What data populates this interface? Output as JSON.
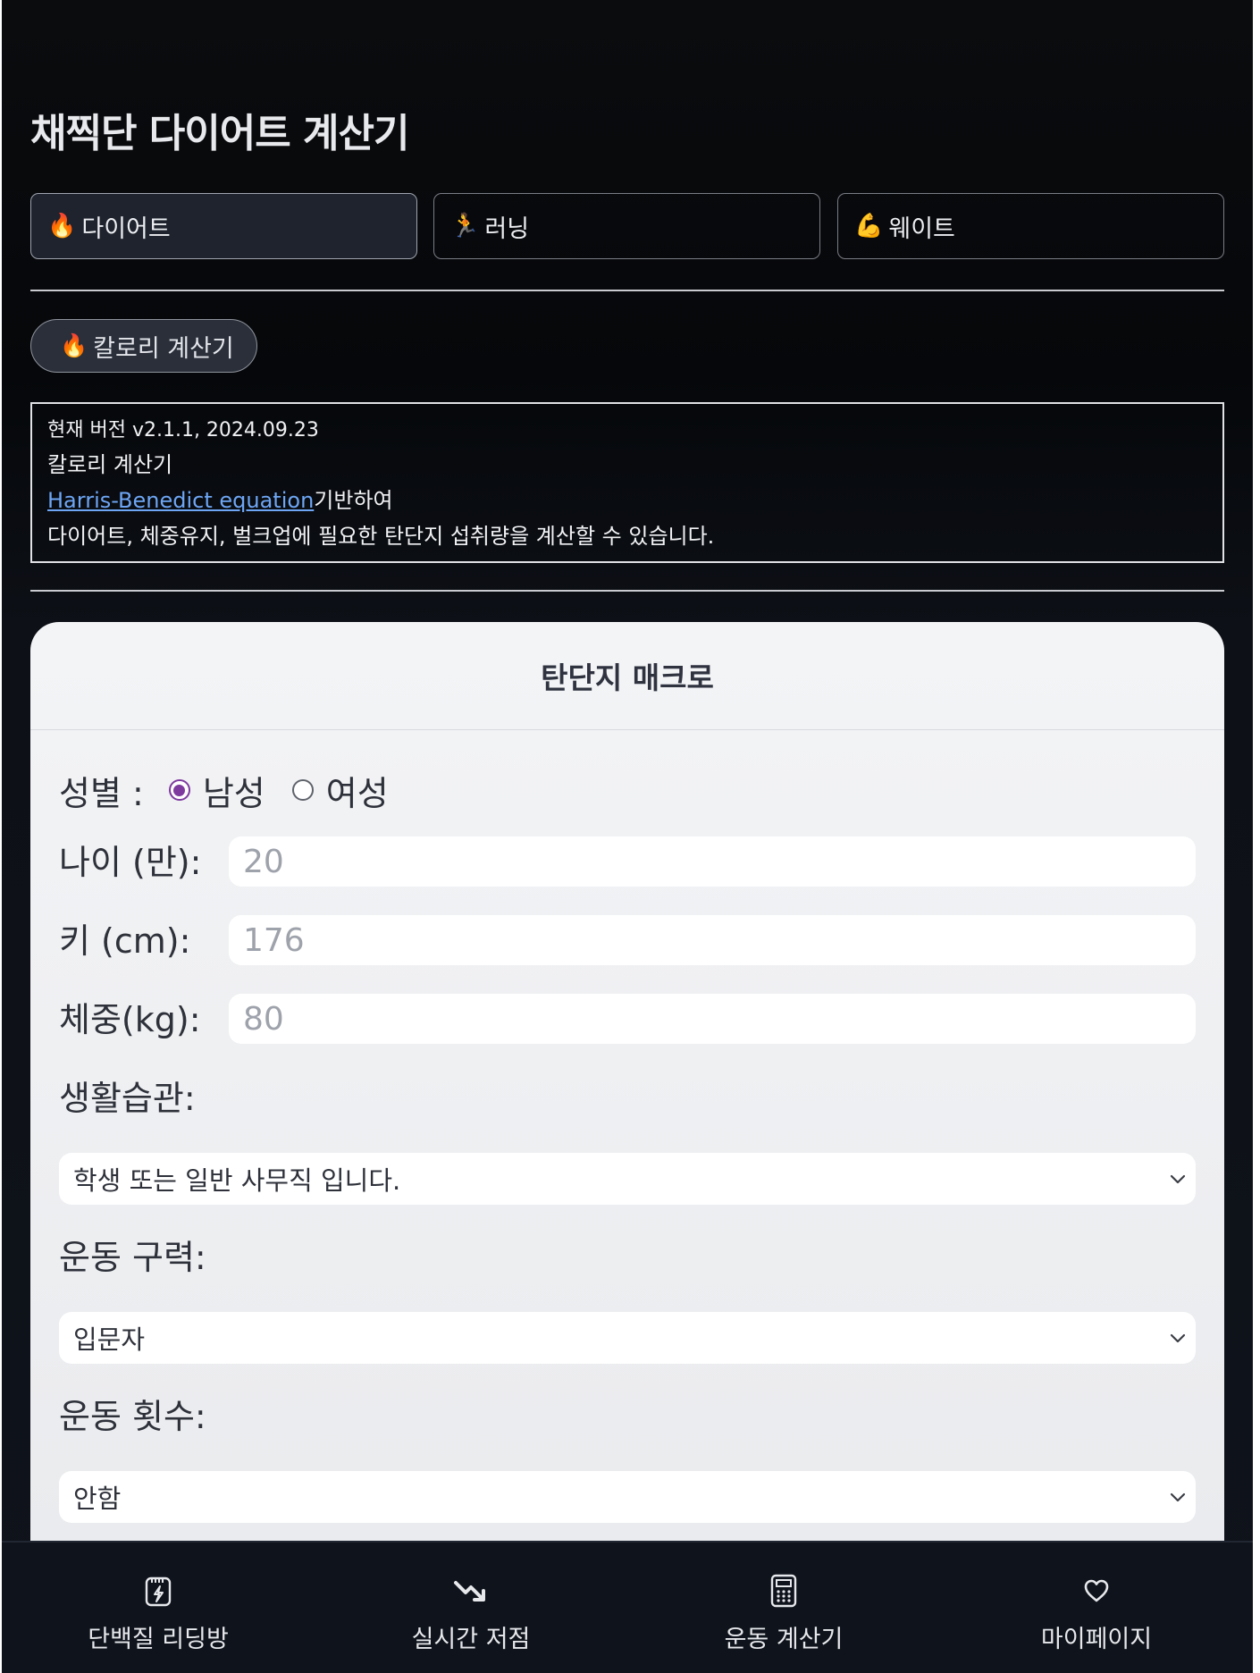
{
  "header": {
    "title": "채찍단 다이어트 계산기"
  },
  "tabs": [
    {
      "icon": "🔥",
      "label": "다이어트",
      "active": true
    },
    {
      "icon": "🏃",
      "label": "러닝",
      "active": false
    },
    {
      "icon": "💪",
      "label": "웨이트",
      "active": false
    }
  ],
  "calculator_pill": {
    "icon": "🔥",
    "label": "칼로리 계산기"
  },
  "info": {
    "version": "현재 버전 v2.1.1, 2024.09.23",
    "name": "칼로리 계산기",
    "link_text": "Harris-Benedict equation",
    "link_suffix": "기반하여",
    "description": "다이어트, 체중유지, 벌크업에 필요한 탄단지 섭취량을 계산할 수 있습니다."
  },
  "card": {
    "title": "탄단지 매크로",
    "gender": {
      "label": "성별 :",
      "options": [
        "남성",
        "여성"
      ],
      "selected": "남성"
    },
    "age": {
      "label": "나이 (만):",
      "placeholder": "20"
    },
    "height": {
      "label": "키 (cm):",
      "placeholder": "176"
    },
    "weight": {
      "label": "체중(kg):",
      "placeholder": "80"
    },
    "lifestyle": {
      "label": "생활습관:",
      "value": "학생 또는 일반 사무직 입니다."
    },
    "experience": {
      "label": "운동 구력:",
      "value": "입문자"
    },
    "frequency": {
      "label": "운동 횟수:",
      "value": "안함"
    }
  },
  "bottom_nav": [
    {
      "label": "단백질 리딩방",
      "icon": "protein-icon"
    },
    {
      "label": "실시간 저점",
      "icon": "trending-down-icon"
    },
    {
      "label": "운동 계산기",
      "icon": "calculator-icon"
    },
    {
      "label": "마이페이지",
      "icon": "heart-icon"
    }
  ]
}
